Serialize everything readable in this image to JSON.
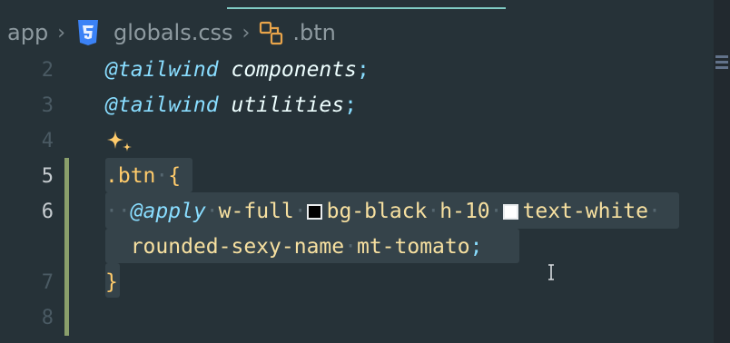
{
  "breadcrumb": {
    "root": "app",
    "file": "globals.css",
    "symbol": ".btn"
  },
  "gutter": {
    "lines": [
      "2",
      "3",
      "4",
      "5",
      "6",
      "",
      "7",
      "8"
    ],
    "active_lines": [
      "5",
      "6"
    ]
  },
  "editor": {
    "line2": {
      "directive": "@tailwind",
      "value": "components",
      "end": ";"
    },
    "line3": {
      "directive": "@tailwind",
      "value": "utilities",
      "end": ";"
    },
    "line5": {
      "selector": ".btn",
      "open": "{"
    },
    "line6": {
      "directive": "@apply",
      "class1": "w-full",
      "class2": "bg-black",
      "class3": "h-10",
      "class4": "text-white",
      "class5": "rounded-sexy-name",
      "class6": "mt-tomato",
      "end": ";"
    },
    "line7": {
      "close": "}"
    }
  },
  "colors": {
    "background": "#263238",
    "swatch_black": "#000000",
    "swatch_white": "#ffffff",
    "change_bar": "#8a9f6b",
    "tab_accent": "#80cbc4"
  },
  "icons": {
    "css_file": "css-file-icon",
    "selector": "css-selector-icon",
    "ai": "sparkle-icon",
    "text_cursor": "text-cursor-icon"
  }
}
